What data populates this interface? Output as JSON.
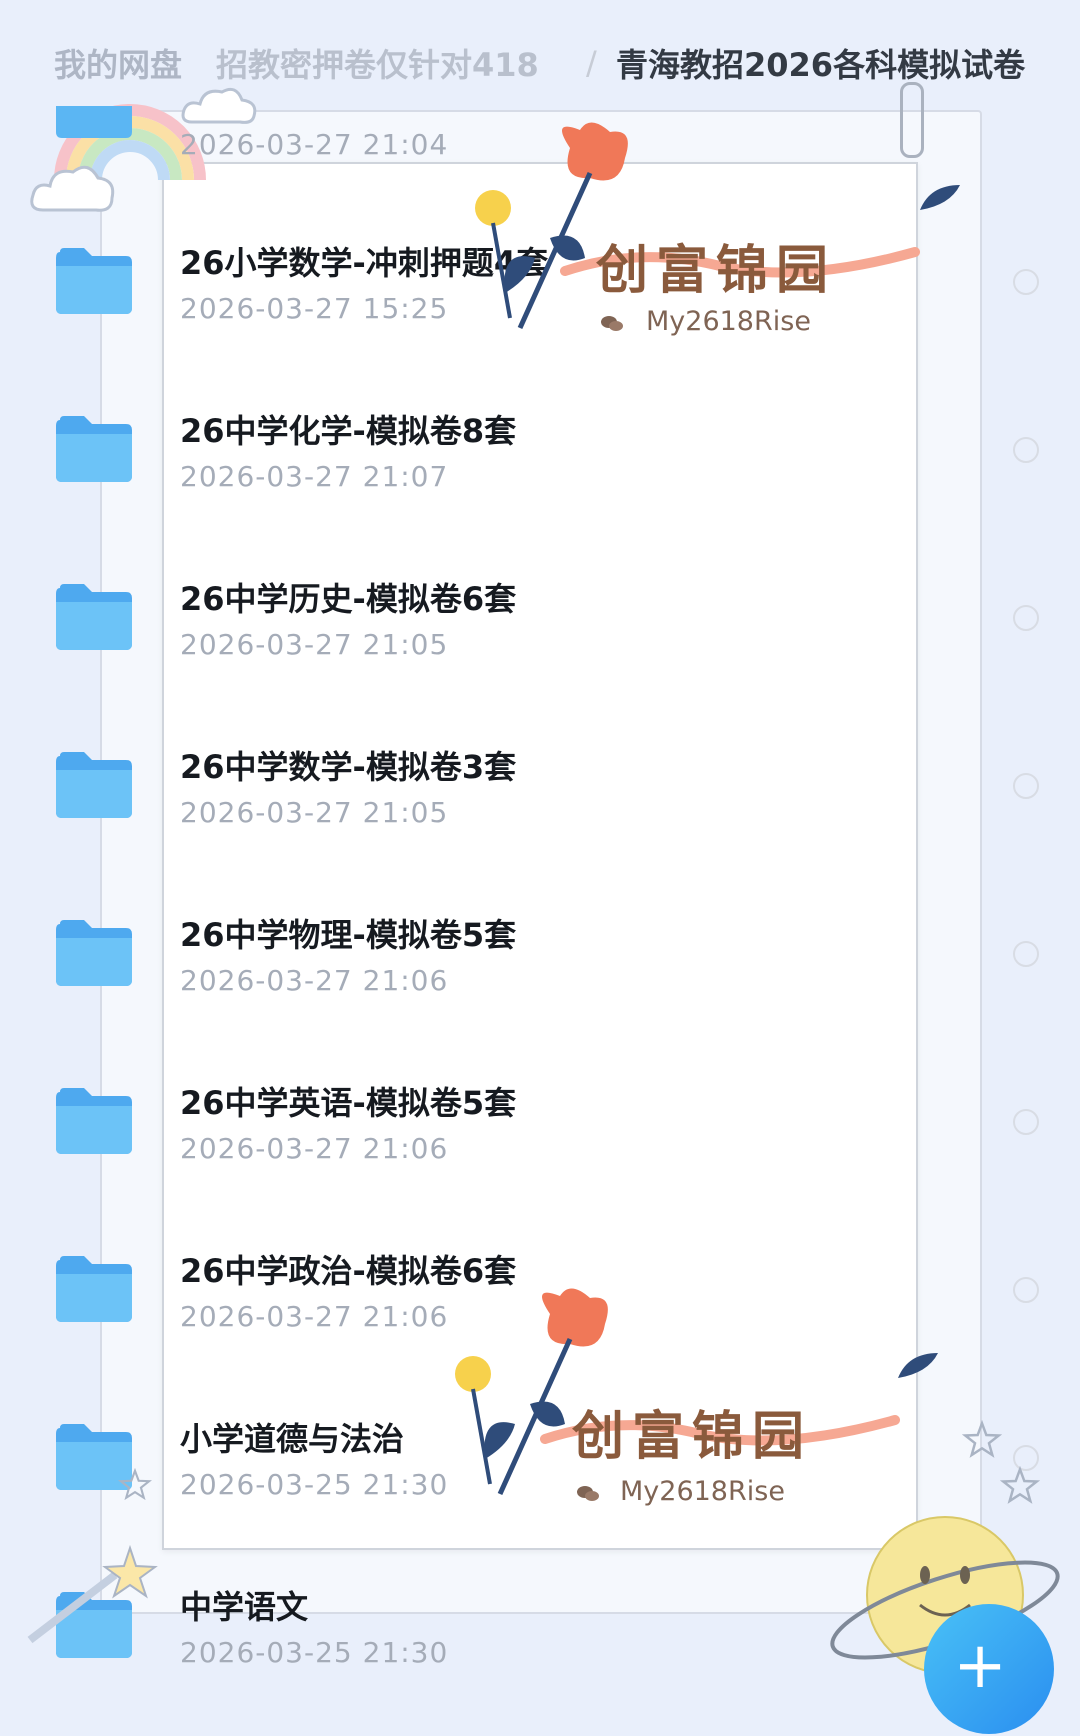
{
  "breadcrumb": {
    "root": "我的网盘",
    "middle": "招教密押卷仅针对418",
    "separator": "/",
    "current": "青海教招2026各科模拟试卷"
  },
  "files": [
    {
      "name": "",
      "date": "2026-03-27 21:04"
    },
    {
      "name": "26小学数学-冲刺押题4套",
      "date": "2026-03-27 15:25"
    },
    {
      "name": "26中学化学-模拟卷8套",
      "date": "2026-03-27 21:07"
    },
    {
      "name": "26中学历史-模拟卷6套",
      "date": "2026-03-27 21:05"
    },
    {
      "name": "26中学数学-模拟卷3套",
      "date": "2026-03-27 21:05"
    },
    {
      "name": "26中学物理-模拟卷5套",
      "date": "2026-03-27 21:06"
    },
    {
      "name": "26中学英语-模拟卷5套",
      "date": "2026-03-27 21:06"
    },
    {
      "name": "26中学政治-模拟卷6套",
      "date": "2026-03-27 21:06"
    },
    {
      "name": "小学道德与法治",
      "date": "2026-03-25 21:30"
    },
    {
      "name": "中学语文",
      "date": "2026-03-25 21:30"
    }
  ],
  "watermark": {
    "title": "创富锦园",
    "handle": "My2618Rise"
  },
  "icons": {
    "folder": "folder-icon",
    "add": "plus-icon"
  },
  "colors": {
    "folder": "#5bb6f3",
    "fab": "#2a8ef0",
    "background": "#e9effb",
    "flower": "#f07858"
  }
}
